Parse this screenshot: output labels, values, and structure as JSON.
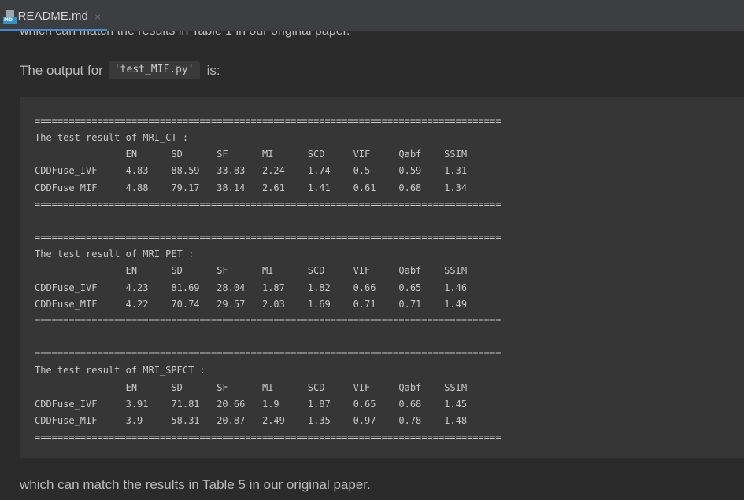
{
  "tab": {
    "icon_label": "MD",
    "title": "README.md",
    "close_glyph": "×"
  },
  "content": {
    "cut_text": "which can match the results in Table 1 in our original paper.",
    "output_prefix": "The output for",
    "output_code": "'test_MIF.py'",
    "output_suffix": "is:",
    "code_block": "==================================================================================\nThe test result of MRI_CT :\n                EN      SD      SF      MI      SCD     VIF     Qabf    SSIM\nCDDFuse_IVF     4.83    88.59   33.83   2.24    1.74    0.5     0.59    1.31\nCDDFuse_MIF     4.88    79.17   38.14   2.61    1.41    0.61    0.68    1.34\n==================================================================================\n\n==================================================================================\nThe test result of MRI_PET :\n                EN      SD      SF      MI      SCD     VIF     Qabf    SSIM\nCDDFuse_IVF     4.23    81.69   28.04   1.87    1.82    0.66    0.65    1.46\nCDDFuse_MIF     4.22    70.74   29.57   2.03    1.69    0.71    0.71    1.49\n==================================================================================\n\n==================================================================================\nThe test result of MRI_SPECT :\n                EN      SD      SF      MI      SCD     VIF     Qabf    SSIM\nCDDFuse_IVF     3.91    71.81   20.66   1.9     1.87    0.65    0.68    1.45\nCDDFuse_MIF     3.9     58.31   20.87   2.49    1.35    0.97    0.78    1.48\n==================================================================================",
    "footer_text": "which can match the results in Table 5 in our original paper."
  },
  "colors": {
    "editor_background": "#2b2b2b",
    "code_background": "#363636",
    "tab_accent": "#4a88c7",
    "text": "#bbbbbb"
  }
}
